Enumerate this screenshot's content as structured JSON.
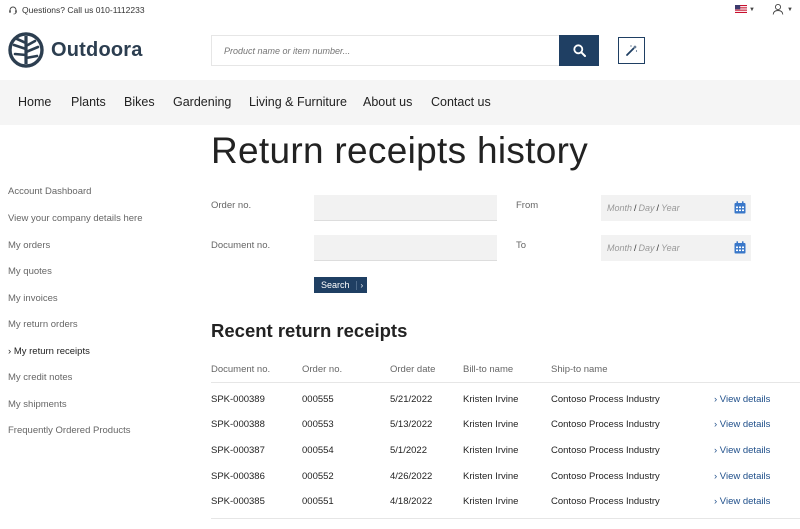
{
  "topbar": {
    "phone_text": "Questions? Call us 010-1112233",
    "icons": [
      "headset-icon",
      "us-flag-icon",
      "user-icon",
      "chevron-down-icon"
    ]
  },
  "brand": {
    "name": "Outdoora"
  },
  "search": {
    "placeholder": "Product name or item number...",
    "icons": [
      "search-icon",
      "magic-wand-icon"
    ]
  },
  "nav": {
    "items": [
      "Home",
      "Plants",
      "Bikes",
      "Gardening",
      "Living & Furniture",
      "About us",
      "Contact us"
    ]
  },
  "page": {
    "title": "Return receipts history"
  },
  "sidebar": {
    "items": [
      "Account Dashboard",
      "View your company details here",
      "My orders",
      "My quotes",
      "My invoices",
      "My return orders",
      "My return receipts",
      "My credit notes",
      "My shipments",
      "Frequently Ordered Products"
    ],
    "active": "My return receipts",
    "active_marker": "›"
  },
  "filters": {
    "order_no_label": "Order no.",
    "document_no_label": "Document no.",
    "from_label": "From",
    "to_label": "To",
    "date_month": "Month",
    "date_day": "Day",
    "date_year": "Year",
    "date_separator": "/",
    "search_button": "Search",
    "search_chevron": "›"
  },
  "recent": {
    "title": "Recent return receipts",
    "columns": [
      "Document no.",
      "Order no.",
      "Order date",
      "Bill-to name",
      "Ship-to name"
    ],
    "view_label": "› View details",
    "rows": [
      {
        "document_no": "SPK-000389",
        "order_no": "000555",
        "order_date": "5/21/2022",
        "bill_to": "Kristen Irvine",
        "ship_to": "Contoso Process Industry"
      },
      {
        "document_no": "SPK-000388",
        "order_no": "000553",
        "order_date": "5/13/2022",
        "bill_to": "Kristen Irvine",
        "ship_to": "Contoso Process Industry"
      },
      {
        "document_no": "SPK-000387",
        "order_no": "000554",
        "order_date": "5/1/2022",
        "bill_to": "Kristen Irvine",
        "ship_to": "Contoso Process Industry"
      },
      {
        "document_no": "SPK-000386",
        "order_no": "000552",
        "order_date": "4/26/2022",
        "bill_to": "Kristen Irvine",
        "ship_to": "Contoso Process Industry"
      },
      {
        "document_no": "SPK-000385",
        "order_no": "000551",
        "order_date": "4/18/2022",
        "bill_to": "Kristen Irvine",
        "ship_to": "Contoso Process Industry"
      }
    ]
  },
  "colors": {
    "brand_navy": "#1f3f63",
    "link_blue": "#1f4f8a",
    "nav_background": "#f5f5f5",
    "input_background": "#f2f2f2",
    "calendar_icon": "#3a78c9"
  }
}
